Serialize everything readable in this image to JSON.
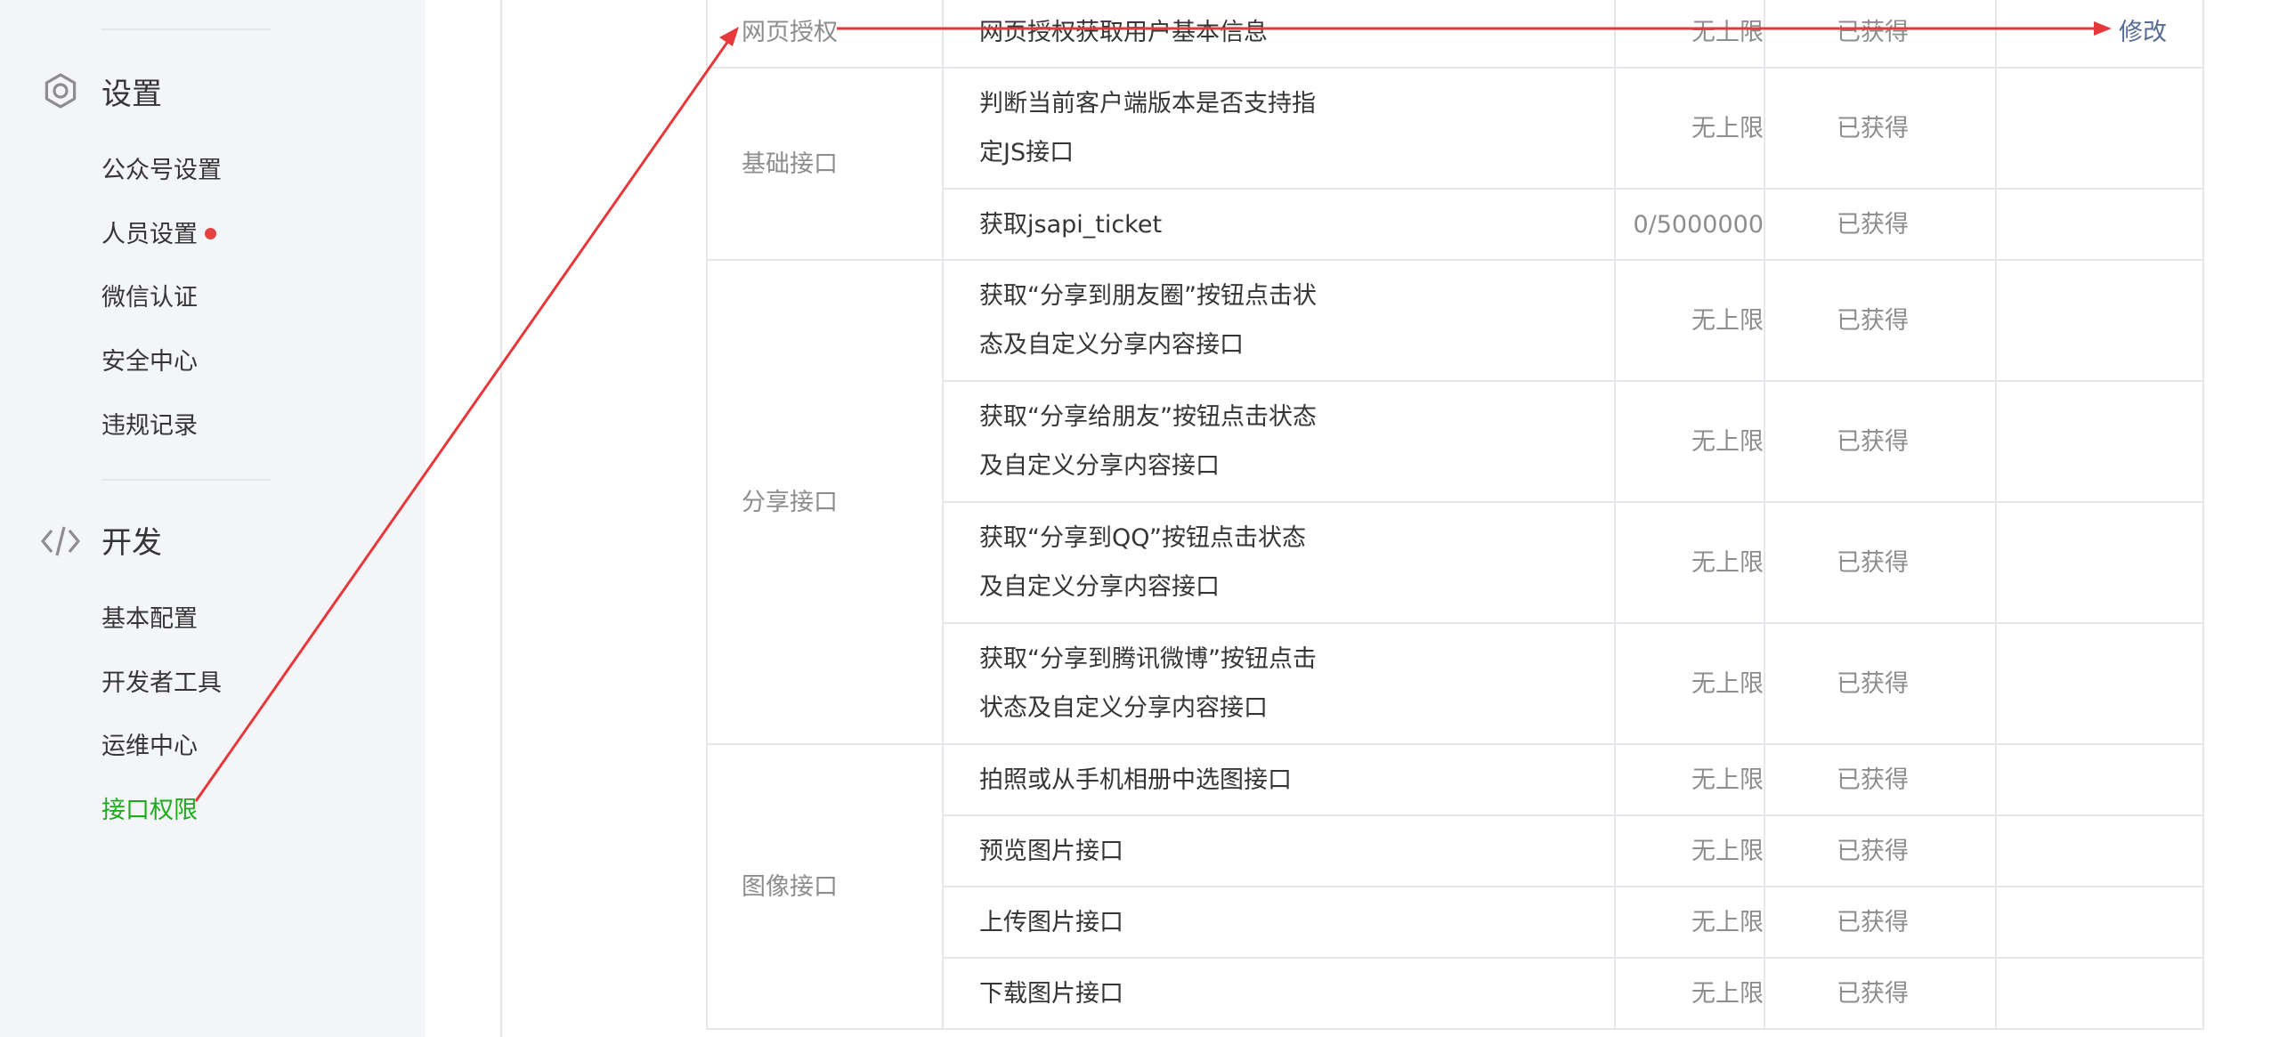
{
  "sidebar": {
    "settings": {
      "title": "设置",
      "icon": "gear-icon",
      "items": [
        {
          "label": "公众号设置"
        },
        {
          "label": "人员设置"
        },
        {
          "label": "微信认证"
        },
        {
          "label": "安全中心"
        },
        {
          "label": "违规记录"
        }
      ]
    },
    "develop": {
      "title": "开发",
      "icon": "code-icon",
      "items": [
        {
          "label": "基本配置"
        },
        {
          "label": "开发者工具"
        },
        {
          "label": "运维中心"
        },
        {
          "label": "接口权限",
          "active": true
        }
      ]
    }
  },
  "table": {
    "groups": [
      {
        "category": "网页授权",
        "rows": [
          {
            "name": "网页授权获取用户基本信息",
            "quota": "无上限",
            "status": "已获得",
            "action": "修改"
          }
        ]
      },
      {
        "category": "基础接口",
        "rows": [
          {
            "name": "判断当前客户端版本是否支持指",
            "name2": "定JS接口",
            "quota": "无上限",
            "status": "已获得"
          },
          {
            "name": "获取jsapi_ticket",
            "quota": "0/5000000",
            "status": "已获得"
          }
        ]
      },
      {
        "category": "分享接口",
        "rows": [
          {
            "name": "获取“分享到朋友圈”按钮点击状",
            "name2": "态及自定义分享内容接口",
            "quota": "无上限",
            "status": "已获得"
          },
          {
            "name": "获取“分享给朋友”按钮点击状态",
            "name2": "及自定义分享内容接口",
            "quota": "无上限",
            "status": "已获得"
          },
          {
            "name": "获取“分享到QQ”按钮点击状态",
            "name2": "及自定义分享内容接口",
            "quota": "无上限",
            "status": "已获得"
          },
          {
            "name": "获取“分享到腾讯微博”按钮点击",
            "name2": "状态及自定义分享内容接口",
            "quota": "无上限",
            "status": "已获得"
          }
        ]
      },
      {
        "category": "图像接口",
        "rows": [
          {
            "name": "拍照或从手机相册中选图接口",
            "quota": "无上限",
            "status": "已获得"
          },
          {
            "name": "预览图片接口",
            "quota": "无上限",
            "status": "已获得"
          },
          {
            "name": "上传图片接口",
            "quota": "无上限",
            "status": "已获得"
          },
          {
            "name": "下载图片接口",
            "quota": "无上限",
            "status": "已获得"
          }
        ]
      }
    ]
  },
  "colors": {
    "annotation": "#e8373a",
    "active": "#1aad19",
    "link": "#576b95",
    "dot": "#e64340"
  }
}
